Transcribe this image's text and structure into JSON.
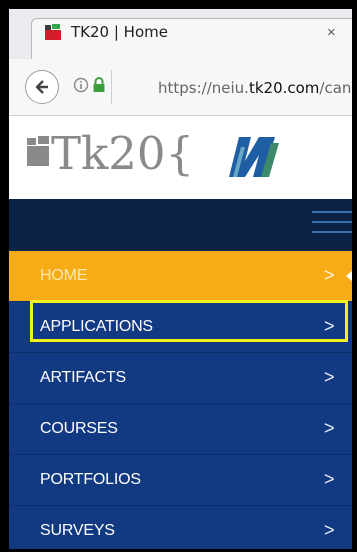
{
  "browser": {
    "tab_title": "TK20 | Home",
    "close_glyph": "×",
    "url_prefix": "https://neiu.",
    "url_domain": "tk20.com",
    "url_suffix": "/can"
  },
  "logo": {
    "text": "Tk20{"
  },
  "menu": {
    "items": [
      {
        "label": "HOME",
        "chevron": ">"
      },
      {
        "label": "APPLICATIONS",
        "chevron": ">"
      },
      {
        "label": "ARTIFACTS",
        "chevron": ">"
      },
      {
        "label": "COURSES",
        "chevron": ">"
      },
      {
        "label": "PORTFOLIOS",
        "chevron": ">"
      },
      {
        "label": "SURVEYS",
        "chevron": ">"
      }
    ]
  },
  "colors": {
    "home_active": "#f7ac17",
    "menu_bg": "#123a82",
    "nav_dark": "#0b2346",
    "highlight": "#f4f11a"
  }
}
